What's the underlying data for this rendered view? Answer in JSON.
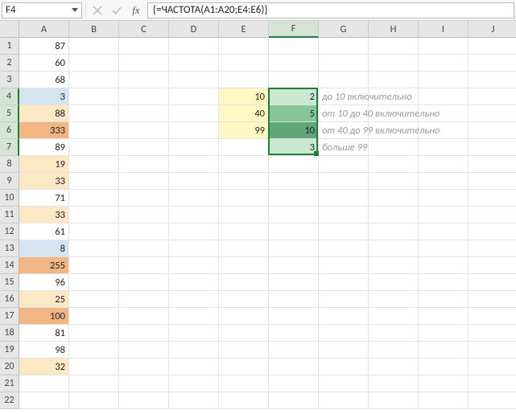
{
  "formula_bar": {
    "name_box": "F4",
    "formula": "{=ЧАСТОТА(A1:A20;E4:E6)}",
    "fx_label": "fx"
  },
  "columns": [
    "A",
    "B",
    "C",
    "D",
    "E",
    "F",
    "G",
    "H",
    "I",
    "J"
  ],
  "rows": 22,
  "active_col_index": 5,
  "selection": {
    "col": 5,
    "row_start": 4,
    "row_end": 7
  },
  "colA": {
    "1": "87",
    "2": "60",
    "3": "68",
    "4": "3",
    "5": "88",
    "6": "333",
    "7": "89",
    "8": "19",
    "9": "33",
    "10": "71",
    "11": "33",
    "12": "61",
    "13": "8",
    "14": "255",
    "15": "96",
    "16": "25",
    "17": "100",
    "18": "81",
    "19": "98",
    "20": "32"
  },
  "colA_fill": {
    "4": "blue",
    "5": "beige",
    "6": "orange",
    "8": "beige",
    "9": "beige",
    "11": "beige",
    "13": "blue",
    "14": "orange",
    "16": "beige",
    "17": "orange",
    "20": "beige"
  },
  "colE": {
    "4": "10",
    "5": "40",
    "6": "99"
  },
  "colF": {
    "4": "2",
    "5": "5",
    "6": "10",
    "7": "3"
  },
  "colF_fill": {
    "4": "green-lt",
    "5": "green-md",
    "6": "green-dk",
    "7": "green-lt"
  },
  "colG": {
    "4": "до 10 включительно",
    "5": "от 10 до 40 включительно",
    "6": "от 40 до 99 включительно",
    "7": "больше 99"
  }
}
